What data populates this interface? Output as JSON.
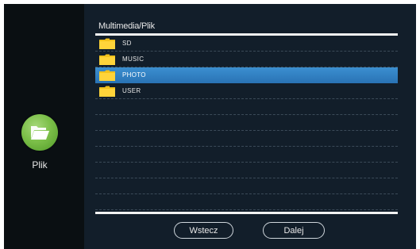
{
  "sidebar": {
    "app_icon": "folder-open-icon",
    "app_label": "Plik",
    "accent": "#7cbf49"
  },
  "header": {
    "breadcrumb": "Multimedia/Plik"
  },
  "list": {
    "selected_color": "#2f7fc2",
    "items": [
      {
        "label": "SD",
        "icon": "folder-icon"
      },
      {
        "label": "MUSIC",
        "icon": "folder-icon"
      },
      {
        "label": "PHOTO",
        "icon": "folder-icon",
        "selected": true
      },
      {
        "label": "USER",
        "icon": "folder-icon"
      },
      {
        "label": ""
      },
      {
        "label": ""
      },
      {
        "label": ""
      },
      {
        "label": ""
      },
      {
        "label": ""
      },
      {
        "label": ""
      },
      {
        "label": ""
      }
    ]
  },
  "footer": {
    "back_label": "Wstecz",
    "next_label": "Dalej"
  }
}
